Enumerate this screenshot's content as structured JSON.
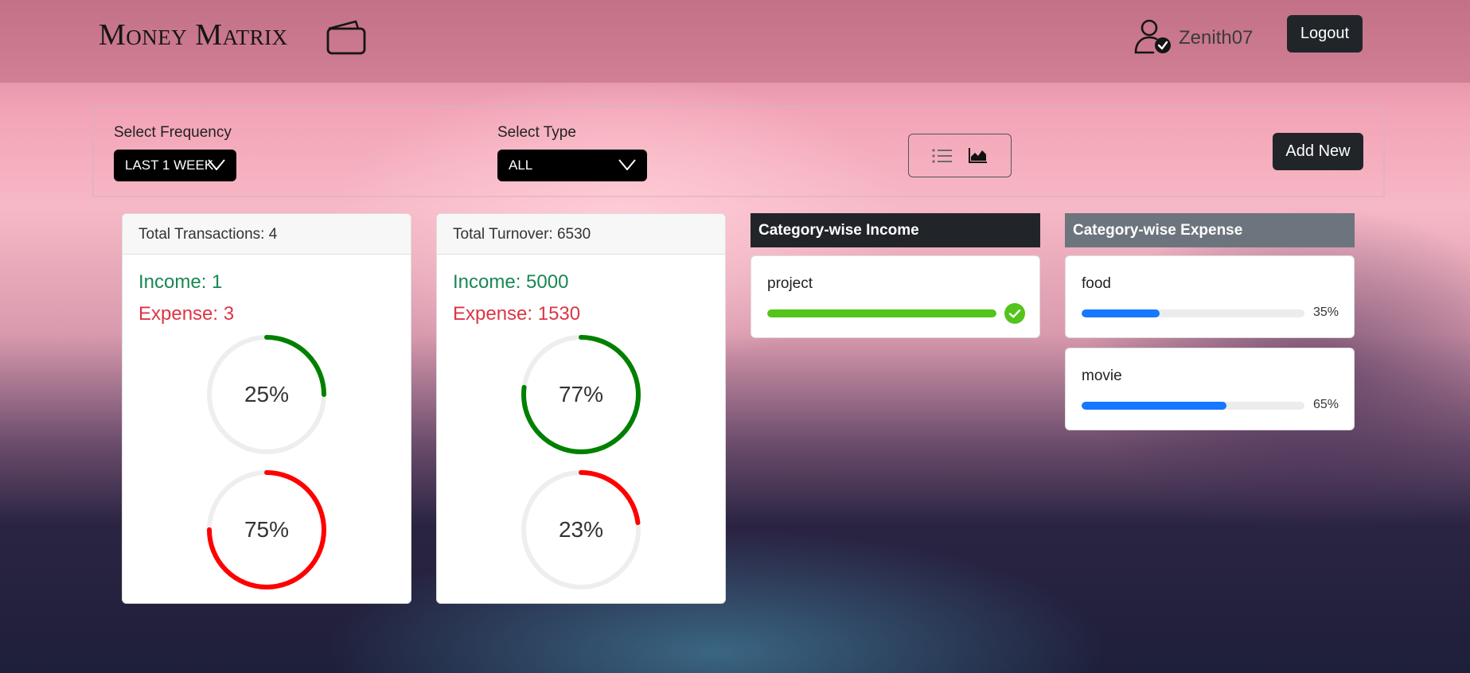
{
  "app": {
    "title": "Money Matrix"
  },
  "user": {
    "name": "Zenith07",
    "logout_label": "Logout"
  },
  "filters": {
    "frequency": {
      "label": "Select Frequency",
      "value": "LAST 1 WEEK"
    },
    "type": {
      "label": "Select Type",
      "value": "ALL"
    },
    "add_label": "Add New"
  },
  "transactions_card": {
    "title": "Total Transactions: 4",
    "income": "Income: 1",
    "expense": "Expense: 3",
    "income_pct_label": "25%",
    "expense_pct_label": "75%",
    "income_pct": 25,
    "expense_pct": 75
  },
  "turnover_card": {
    "title": "Total Turnover: 6530",
    "income": "Income: 5000",
    "expense": "Expense: 1530",
    "income_pct_label": "77%",
    "expense_pct_label": "23%",
    "income_pct": 77,
    "expense_pct": 23
  },
  "category_income": {
    "title": "Category-wise Income",
    "items": [
      {
        "name": "project",
        "percent": 100
      }
    ]
  },
  "category_expense": {
    "title": "Category-wise Expense",
    "items": [
      {
        "name": "food",
        "percent": 35,
        "label": "35%"
      },
      {
        "name": "movie",
        "percent": 65,
        "label": "65%"
      }
    ]
  },
  "colors": {
    "income": "#198754",
    "expense": "#dc3545",
    "ring_income": "#008000",
    "ring_expense": "#ff0000",
    "progress_success": "#52c41a",
    "progress_normal": "#1677ff",
    "income_header": "#212529",
    "expense_header": "#6c757d"
  },
  "icons": {
    "brand": "wallet-icon",
    "user": "user-check-icon",
    "list_view": "list-icon",
    "chart_view": "area-chart-icon",
    "dropdown": "chevron-down-icon",
    "complete": "check-circle-icon"
  }
}
